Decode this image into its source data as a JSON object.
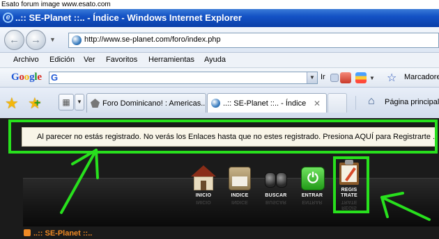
{
  "source_banner": "Esato forum image www.esato.com",
  "window": {
    "title": "..:: SE-Planet ::.. - Índice - Windows Internet Explorer"
  },
  "navigation": {
    "address": "http://www.se-planet.com/foro/index.php"
  },
  "menu": {
    "items": [
      "Archivo",
      "Edición",
      "Ver",
      "Favoritos",
      "Herramientas",
      "Ayuda"
    ]
  },
  "google_toolbar": {
    "logo_letters": [
      "G",
      "o",
      "o",
      "g",
      "l",
      "e"
    ],
    "search_value": "",
    "go_label": "Ir",
    "bookmarks_label": "Marcadores"
  },
  "tabs": [
    {
      "label": "Foro Dominicano! : Americas...",
      "active": false
    },
    {
      "label": "..:: SE-Planet ::.. - Índice",
      "active": true
    }
  ],
  "home": {
    "label": "Página principal"
  },
  "notice": {
    "text": "Al parecer no estás registrado. No verás los Enlaces hasta que no estes registrado. Presiona AQUÍ para Registrarte ..."
  },
  "forum_nav": [
    {
      "label": "INICIO"
    },
    {
      "label": "INDICE"
    },
    {
      "label": "BUSCAR"
    },
    {
      "label": "ENTRAR"
    },
    {
      "label": "REGIS TRATE"
    }
  ],
  "forum": {
    "title": "..:: SE-Planet ::.."
  },
  "colors": {
    "highlight": "#28e01d",
    "forum_title": "#f08a24",
    "titlebar": "#1452c5"
  }
}
